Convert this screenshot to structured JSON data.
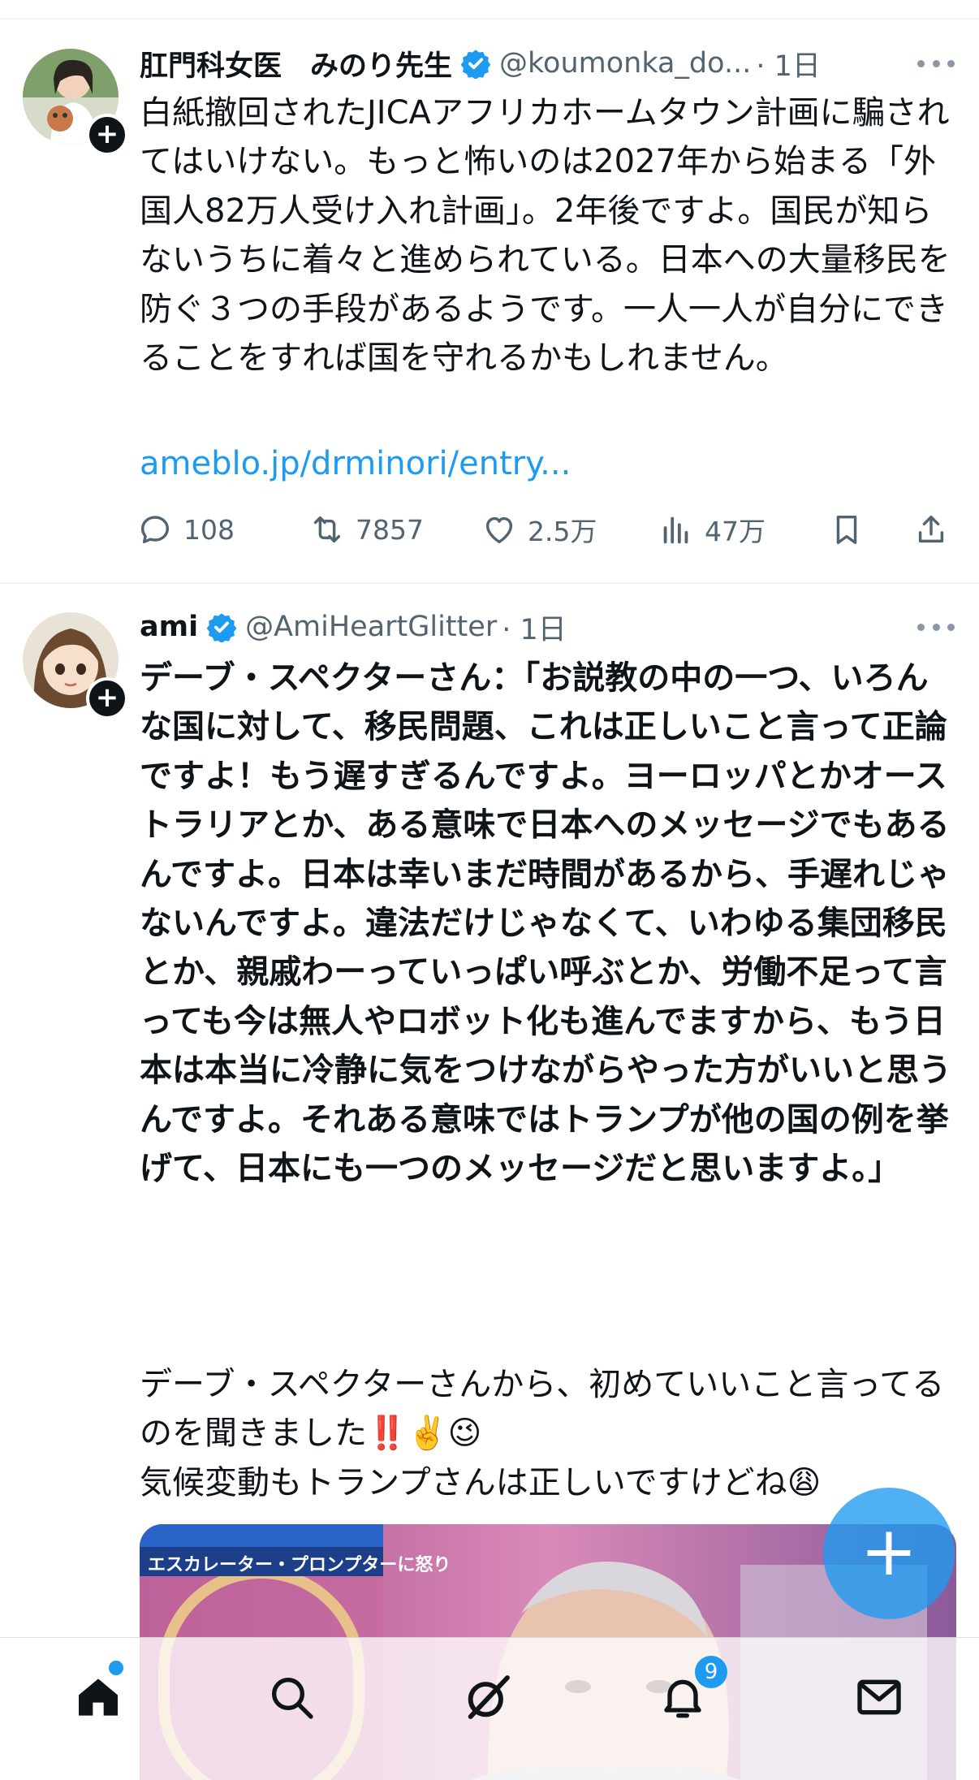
{
  "tweets": [
    {
      "display_name": "肛門科女医　みのり先生",
      "handle": "@koumonka_do...",
      "time": "· 1日",
      "text": "白紙撤回されたJICAアフリカホームタウン計画に騙されてはいけない。もっと怖いのは2027年から始まる「外国人82万人受け入れ計画」。2年後ですよ。国民が知らないうちに着々と進められている。日本への大量移民を防ぐ３つの手段があるようです。一人一人が自分にできることをすれば国を守れるかもしれません。",
      "link": "ameblo.jp/drminori/entry...",
      "replies": "108",
      "retweets": "7857",
      "likes": "2.5万",
      "views": "47万"
    },
    {
      "display_name": "ami",
      "handle": "@AmiHeartGlitter",
      "time": "· 1日",
      "text_bold": "デーブ・スペクターさん：「お説教の中の一つ、いろんな国に対して、移民問題、これは正しいこと言って正論ですよ！もう遅すぎるんですよ。ヨーロッパとかオーストラリアとか、ある意味で日本へのメッセージでもあるんですよ。日本は幸いまだ時間があるから、手遅れじゃないんですよ。違法だけじゃなくて、いわゆる集団移民とか、親戚わーっていっぱい呼ぶとか、労働不足って言っても今は無人やロボット化も進んでますから、もう日本は本当に冷静に気をつけながらやった方がいいと思うんですよ。それある意味ではトランプが他の国の例を挙げて、日本にも一つのメッセージだと思いますよ。」",
      "text_normal": "デーブ・スペクターさんから、初めていいこと言ってるのを聞きました‼️✌️😉\n気候変動もトランプさんは正しいですけどね😩",
      "media_caption": "エスカレーター・プロンプターに怒り"
    }
  ],
  "fab": {
    "label": "+"
  },
  "nav": {
    "notifications_badge": "9"
  },
  "colors": {
    "accent": "#1d9bf0",
    "secondary_text": "#536471",
    "primary_text": "#0f1419"
  }
}
